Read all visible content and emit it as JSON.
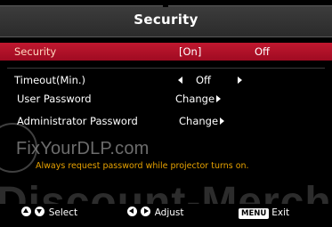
{
  "osd": {
    "title": "Security",
    "items": [
      {
        "label": "Security",
        "value_selected": "[On]",
        "value_other": "Off"
      },
      {
        "label": "Timeout(Min.)",
        "value": "Off"
      },
      {
        "label": "User Password",
        "value": "Change"
      },
      {
        "label": "Administrator Password",
        "value": "Change"
      }
    ],
    "info": "Always request password while projector turns on.",
    "watermark": {
      "site": "FixYourDLP.com",
      "background": "Discount-Merch"
    },
    "hints": {
      "select": "Select",
      "adjust": "Adjust",
      "menu_key": "MENU",
      "exit": "Exit"
    }
  },
  "colors": {
    "background": "#000000",
    "selected_row": "#b0102a",
    "info_text": "#e6a100",
    "title_bar": "#333333"
  }
}
